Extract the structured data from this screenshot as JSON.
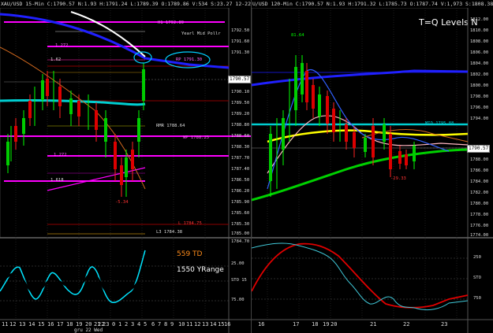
{
  "left": {
    "header": "XAU/USD 15-Min C:1790.57 N:1.93 H:1791.24 L:1789.39 O:1789.86 V:534 S:23.27 12-22-21 5:55",
    "price_ticks": [
      "1792.50",
      "1791.60",
      "1791.30",
      "1790.57",
      "1790.10",
      "1789.50",
      "1789.20",
      "1788.80",
      "1788.60",
      "1788.30",
      "1787.70",
      "1787.40",
      "1786.50",
      "1786.20",
      "1785.90",
      "1785.60",
      "1785.30",
      "1785.00",
      "1784.70"
    ],
    "current_price": "1790.57",
    "labels": {
      "yearly_mid": "Yearl Mid Pollr",
      "h_level": "H1 1792.89",
      "rp_level": "RP 1791.30",
      "rm_level": "RMR 1788.64",
      "wp_level": "WP 1788.25",
      "l3_level": "L3 1784.38",
      "l_level": "L 1784.75",
      "fib_a": "1.272",
      "fib_b": "1.272",
      "fib_c": "1.62",
      "fib_d": "1.618",
      "low_val": "-5.34"
    },
    "osc": {
      "td": "559 TD",
      "yrange": "1550 YRange",
      "ticks": [
        "25.00",
        "STO 15",
        "75.00"
      ]
    },
    "xaxis": [
      "11",
      "12",
      "13",
      "14",
      "15",
      "16",
      "17",
      "18",
      "19",
      "20",
      "21",
      "22",
      "23",
      "0",
      "1",
      "2",
      "3",
      "4",
      "5",
      "6",
      "7",
      "8",
      "9",
      "10",
      "11",
      "12",
      "13",
      "14",
      "15",
      "16"
    ],
    "date_label": "gru 22 Wed"
  },
  "right": {
    "header": "U/USD 120-Min C:1790.57 N:1.93 H:1791.32 L:1785.73 O:1787.74 V:1,973 S:1808.38 12-22-21 1:05:55",
    "title": "T=Q Levels N",
    "price_ticks": [
      "1812.00",
      "1810.00",
      "1808.00",
      "1806.00",
      "1804.00",
      "1802.00",
      "1800.00",
      "1798.00",
      "1796.00",
      "1794.00",
      "1790.57",
      "1788.00",
      "1786.00",
      "1784.00",
      "1782.00",
      "1780.00",
      "1778.00",
      "1776.00",
      "1774.00"
    ],
    "current_price": "1790.57",
    "labels": {
      "peak": "81.64",
      "mid_level": "MID 1795.88",
      "low_val": "-29.33"
    },
    "osc_ticks": [
      "250",
      "STO",
      "750"
    ],
    "xaxis": [
      "16",
      "17",
      "18",
      "19",
      "20",
      "21",
      "22",
      "23"
    ]
  },
  "colors": {
    "background": "#000000",
    "magenta": "#ff00ff",
    "blue": "#1a1aff",
    "cyan": "#00ced1",
    "yellow": "#ffff00",
    "green": "#00e000",
    "red": "#ff1a1a",
    "orange": "#d2691e",
    "white": "#ffffff"
  }
}
